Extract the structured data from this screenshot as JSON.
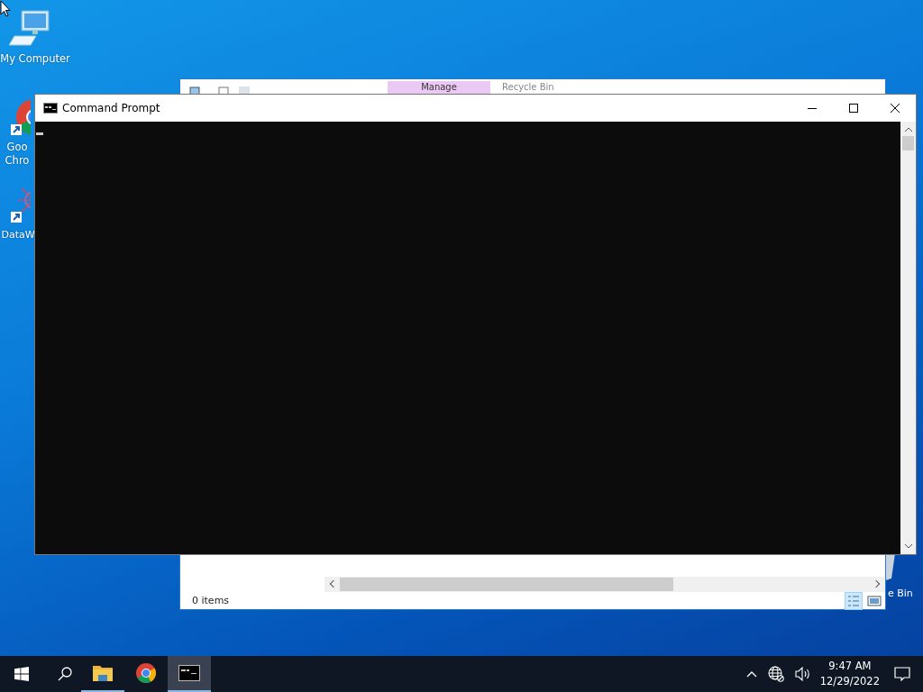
{
  "desktop_icons": [
    {
      "kind": "computer",
      "label": "My Computer"
    },
    {
      "kind": "chrome",
      "label": "Goo Chro"
    },
    {
      "kind": "datawave",
      "label": "DataW"
    }
  ],
  "explorer_window": {
    "ribbon_tab": "Manage",
    "title": "Recycle Bin",
    "status": "0 items",
    "desktop_label": "e Bin"
  },
  "cmd_window": {
    "title": "Command Prompt"
  },
  "taskbar": {
    "apps": [
      {
        "kind": "folder",
        "running": true,
        "selected": false
      },
      {
        "kind": "chrome",
        "running": false,
        "selected": false
      },
      {
        "kind": "console",
        "running": true,
        "selected": true
      }
    ],
    "time": "9:47 AM",
    "date": "12/29/2022"
  }
}
